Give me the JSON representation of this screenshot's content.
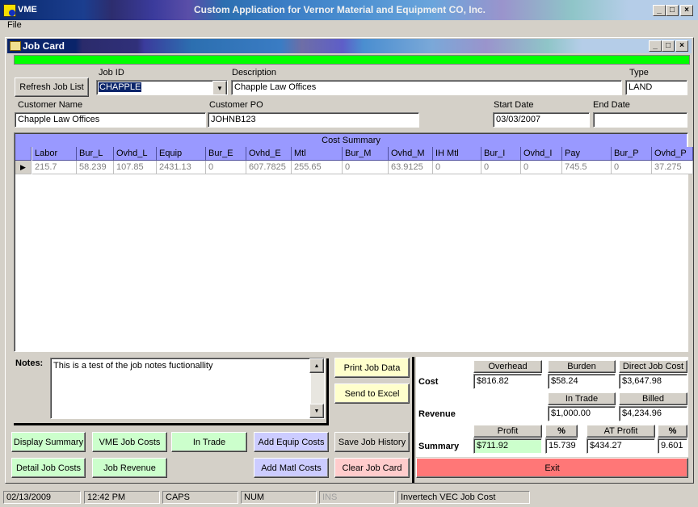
{
  "app": {
    "short_name": "VME",
    "title": "Custom Application for Vernor Material and Equipment CO, Inc.",
    "menu_file": "File"
  },
  "window": {
    "title": "Job Card",
    "min": "_",
    "max": "□",
    "close": "×"
  },
  "form": {
    "refresh_label": "Refresh Job List",
    "job_id_label": "Job ID",
    "job_id_value": "CHAPPLE",
    "description_label": "Description",
    "description_value": "Chapple Law Offices",
    "type_label": "Type",
    "type_value": "LAND",
    "customer_name_label": "Customer Name",
    "customer_name_value": "Chapple Law Offices",
    "customer_po_label": "Customer PO",
    "customer_po_value": "JOHNB123",
    "start_date_label": "Start Date",
    "start_date_value": "03/03/2007",
    "end_date_label": "End Date",
    "end_date_value": ""
  },
  "grid": {
    "caption": "Cost Summary",
    "columns": [
      "Labor",
      "Bur_L",
      "Ovhd_L",
      "Equip",
      "Bur_E",
      "Ovhd_E",
      "Mtl",
      "Bur_M",
      "Ovhd_M",
      "IH Mtl",
      "Bur_I",
      "Ovhd_I",
      "Pay",
      "Bur_P",
      "Ovhd_P"
    ],
    "row": [
      "215.7",
      "58.239",
      "107.85",
      "2431.13",
      "0",
      "607.7825",
      "255.65",
      "0",
      "63.9125",
      "0",
      "0",
      "0",
      "745.5",
      "0",
      "37.275"
    ]
  },
  "notes": {
    "label": "Notes:",
    "text": "This is a test of the job notes fuctionallity"
  },
  "buttons": {
    "print_job_data": "Print Job Data",
    "send_to_excel": "Send to Excel",
    "display_summary": "Display Summary",
    "vme_job_costs": "VME Job Costs",
    "in_trade": "In Trade",
    "add_equip_costs": "Add Equip Costs",
    "save_job_history": "Save Job History",
    "detail_job_costs": "Detail Job Costs",
    "job_revenue": "Job Revenue",
    "add_matl_costs": "Add Matl Costs",
    "clear_job_card": "Clear Job Card",
    "exit": "Exit"
  },
  "summary": {
    "cost_label": "Cost",
    "revenue_label": "Revenue",
    "summary_label": "Summary",
    "overhead_label": "Overhead",
    "burden_label": "Burden",
    "direct_job_cost_label": "Direct Job Cost",
    "in_trade_label": "In Trade",
    "billed_label": "Billed",
    "profit_label": "Profit",
    "pct_label": "%",
    "at_profit_label": "AT Profit",
    "pct2_label": "%",
    "overhead_value": "$816.82",
    "burden_value": "$58.24",
    "direct_job_cost_value": "$3,647.98",
    "in_trade_value": "$1,000.00",
    "billed_value": "$4,234.96",
    "profit_value": "$711.92",
    "pct_value": "15.739",
    "at_profit_value": "$434.27",
    "pct2_value": "9.601"
  },
  "status": {
    "date": "02/13/2009",
    "time": "12:42 PM",
    "caps": "CAPS",
    "num": "NUM",
    "ins": "INS",
    "product": "Invertech VEC  Job Cost"
  },
  "colors": {
    "progress": "#00ff00",
    "grid_header": "#9999ff",
    "green_btn": "#ccffcc",
    "yellow_btn": "#ffffcc",
    "blue_btn": "#ccccff",
    "pink_btn": "#ffcccc",
    "exit_btn": "#ff7777"
  }
}
